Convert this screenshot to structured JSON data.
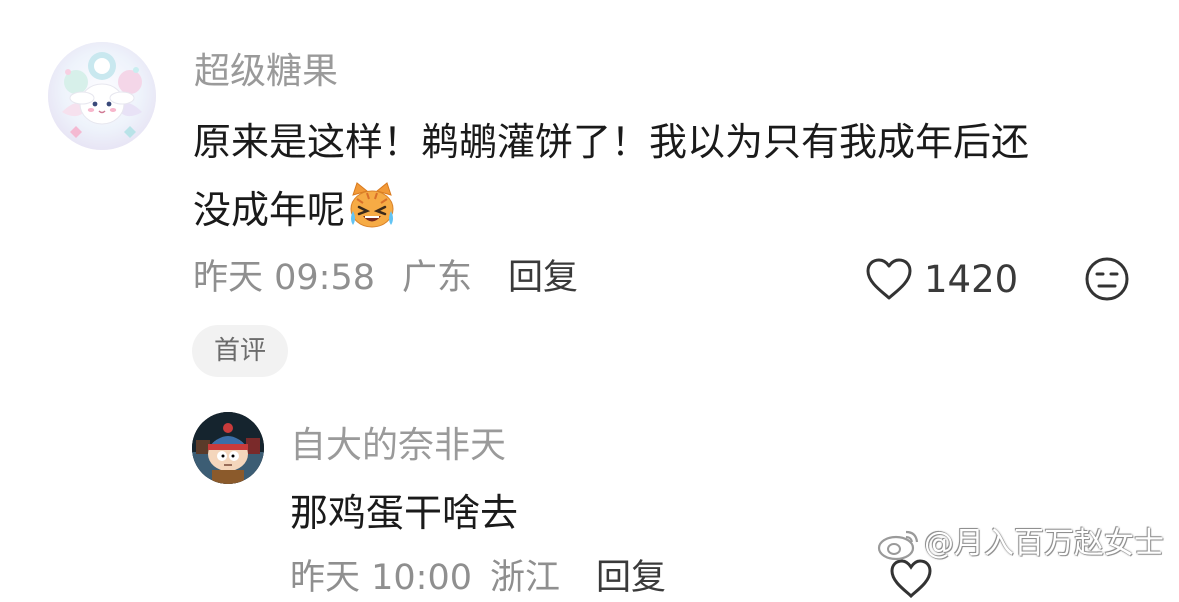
{
  "comment": {
    "username": "超级糖果",
    "content_line1": "原来是这样！鹈鹕灌饼了！我以为只有我成年后还",
    "content_line2": "没成年呢",
    "emoji_icon": "crying-laughing-cat-emoji",
    "time": "昨天 09:58",
    "location": "广东",
    "reply_label": "回复",
    "like_count": "1420",
    "badge": "首评"
  },
  "reply": {
    "username": "自大的奈非天",
    "content": "那鸡蛋干啥去",
    "time": "昨天 10:00",
    "location": "浙江",
    "reply_label": "回复"
  },
  "watermark": {
    "text": "@月入百万赵女士"
  },
  "colors": {
    "username": "#9a9a9a",
    "content": "#1a1a1a",
    "meta": "#8f8f8f",
    "badge_bg": "#f2f2f2"
  }
}
